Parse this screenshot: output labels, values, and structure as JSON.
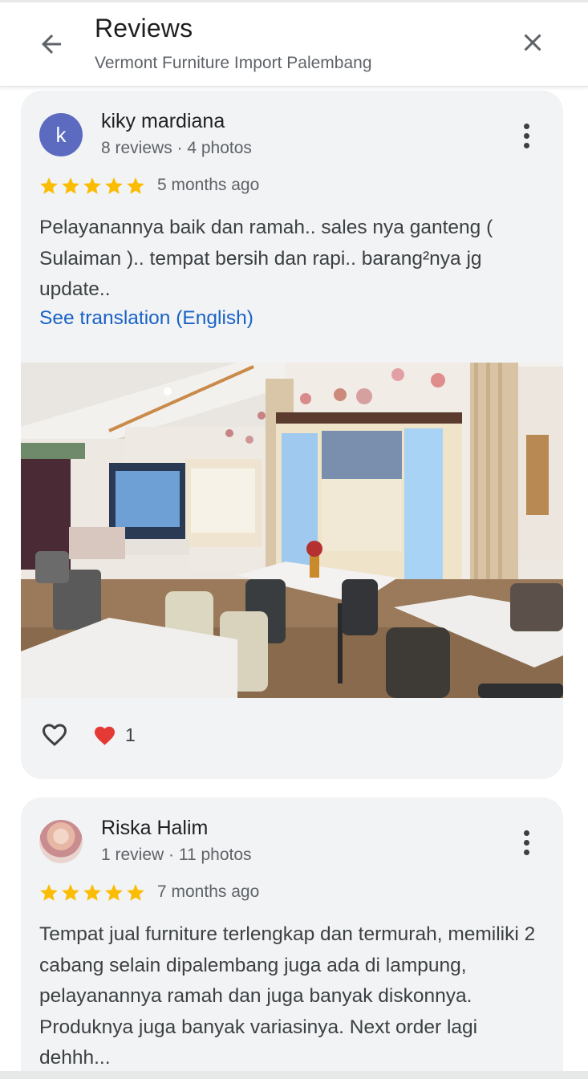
{
  "header": {
    "title": "Reviews",
    "subtitle": "Vermont Furniture Import Palembang",
    "back_icon": "arrow-left-icon",
    "close_icon": "close-icon"
  },
  "reviews": [
    {
      "avatar_letter": "k",
      "avatar_color": "#5c6bc0",
      "name": "kiky mardiana",
      "meta": "8 reviews · 4 photos",
      "rating": 5,
      "time": "5 months ago",
      "text": "Pelayanannya baik dan ramah.. sales nya ganteng ( Sulaiman ).. tempat bersih dan rapi.. barang²nya jg update..",
      "translate_link": "See translation (English)",
      "like_count": "1"
    },
    {
      "avatar_letter": "",
      "name": "Riska Halim",
      "meta": "1 review · 11 photos",
      "rating": 5,
      "time": "7 months ago",
      "text": "Tempat jual furniture terlengkap dan termurah, memiliki 2 cabang selain dipalembang juga ada di lampung, pelayanannya ramah dan juga banyak diskonnya. Produknya juga banyak variasinya. Next order lagi dehhh..."
    }
  ],
  "colors": {
    "star": "#fbbc04",
    "link": "#1a62c6",
    "card_bg": "#f1f3f4",
    "heart": "#e53935"
  }
}
